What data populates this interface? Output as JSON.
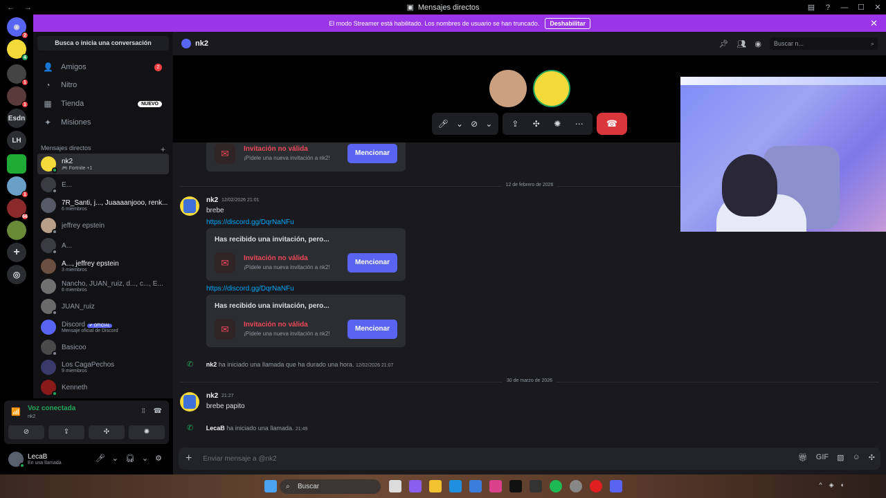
{
  "window": {
    "title": "Mensajes directos"
  },
  "banner": {
    "text": "El modo Streamer está habilitado. Los nombres de usuario se han truncado.",
    "button": "Deshabilitar"
  },
  "rail": {
    "servers": [
      {
        "label": "",
        "badge": "2"
      },
      {
        "label": "",
        "badge": "4"
      },
      {
        "label": "",
        "badge": "1"
      },
      {
        "label": "",
        "badge": "1"
      },
      {
        "label": "Esdn",
        "badge": ""
      },
      {
        "label": "LH",
        "badge": ""
      },
      {
        "label": "",
        "badge": ""
      },
      {
        "label": "",
        "badge": "1"
      },
      {
        "label": "",
        "badge": "66"
      },
      {
        "label": "",
        "badge": ""
      }
    ]
  },
  "sidebar": {
    "search_label": "Busca o inicia una conversación",
    "nav": [
      {
        "label": "Amigos",
        "badge": "2"
      },
      {
        "label": "Nitro",
        "badge": ""
      },
      {
        "label": "Tienda",
        "badge": "NUEVO"
      },
      {
        "label": "Misiones",
        "badge": ""
      }
    ],
    "dm_header": "Mensajes directos",
    "dms": [
      {
        "name": "nk2",
        "sub": "🎮 Fortnite +1"
      },
      {
        "name": "E...",
        "sub": ""
      },
      {
        "name": "7R_Santi, j..., Juaaaanjooo, renk...",
        "sub": "6 miembros"
      },
      {
        "name": "jeffrey epstein",
        "sub": ""
      },
      {
        "name": "A...",
        "sub": ""
      },
      {
        "name": "A..., jeffrey epstein",
        "sub": "3 miembros"
      },
      {
        "name": "Nancho, JUAN_ruiz, d..., c..., E...",
        "sub": "6 miembros"
      },
      {
        "name": "JUAN_ruiz",
        "sub": ""
      },
      {
        "name": "Discord",
        "sub": "Mensaje oficial de Discord",
        "tag": "✔ OFICIAL"
      },
      {
        "name": "Basicoo",
        "sub": ""
      },
      {
        "name": "Los CagaPechos",
        "sub": "9 miembros"
      },
      {
        "name": "Kenneth",
        "sub": ""
      }
    ]
  },
  "voice": {
    "title": "Voz conectada",
    "sub": "nk2"
  },
  "user": {
    "name": "LecaB",
    "status": "En una llamada"
  },
  "chat": {
    "header_name": "nk2",
    "search_placeholder": "Buscar n...",
    "invite": {
      "title": "Has recibido una invitación, pero...",
      "invalid": "Invitación no válida",
      "hint": "¡Pídele una nueva invitación a nk2!",
      "button": "Mencionar"
    },
    "date1": "12 de febrero de 2026",
    "msg1": {
      "author": "nk2",
      "ts": "12/02/2026 21:01",
      "body": "brebe"
    },
    "link": "https://discord.gg/DqrNaNFu",
    "call1": {
      "author": "nk2",
      "text": "ha iniciado una llamada que ha durado una hora.",
      "ts": "12/02/2026 21:07"
    },
    "date2": "30 de marzo de 2026",
    "msg2": {
      "author": "nk2",
      "ts": "21:27",
      "body": "brebe papito"
    },
    "call2": {
      "author": "LecaB",
      "text": "ha iniciado una llamada.",
      "ts": "21:49"
    },
    "composer_placeholder": "Enviar mensaje a @nk2"
  },
  "taskbar": {
    "search": "Buscar"
  },
  "colors": {
    "accent": "#5865f2",
    "banner": "#9a35e8",
    "danger": "#da373c",
    "online": "#23a55a",
    "link": "#00a8fc"
  }
}
